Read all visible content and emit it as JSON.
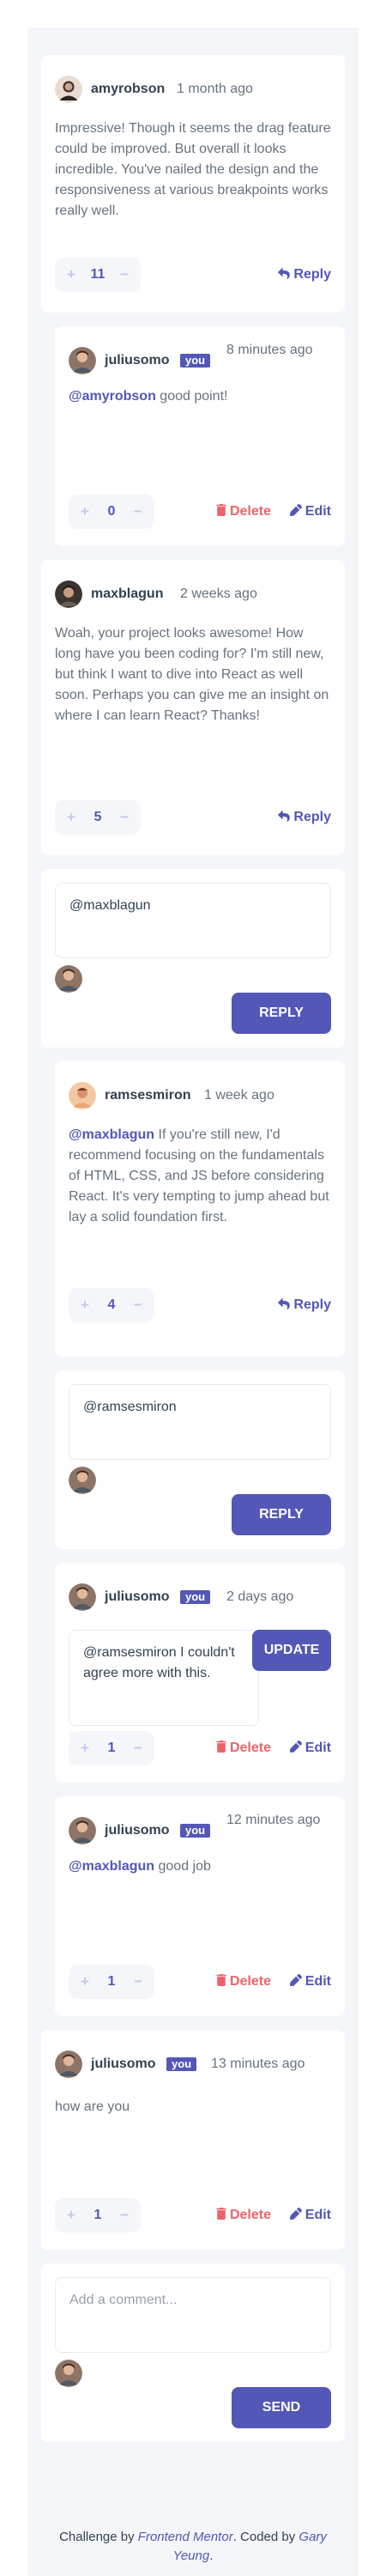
{
  "actions": {
    "reply": "Reply",
    "delete": "Delete",
    "edit": "Edit",
    "you_badge": "you"
  },
  "comments": [
    {
      "username": "amyrobson",
      "date": "1 month ago",
      "content": "Impressive! Though it seems the drag feature could be improved. But overall it looks incredible. You've nailed the design and the responsiveness at various breakpoints works really well.",
      "score": "11"
    },
    {
      "username": "juliusomo",
      "date": "8 minutes ago",
      "mention": "@amyrobson",
      "content": " good point!",
      "score": "0"
    },
    {
      "username": "maxblagun",
      "date": "2 weeks ago",
      "content": "Woah, your project looks awesome! How long have you been coding for? I'm still new, but think I want to dive into React as well soon. Perhaps you can give me an insight on where I can learn React? Thanks!",
      "score": "5"
    },
    {
      "username": "ramsesmiron",
      "date": "1 week ago",
      "mention": "@maxblagun",
      "content": " If you're still new, I'd recommend focusing on the fundamentals of HTML, CSS, and JS before considering React. It's very tempting to jump ahead but lay a solid foundation first.",
      "score": "4"
    },
    {
      "username": "juliusomo",
      "date": "2 days ago",
      "edit_value": "@ramsesmiron I couldn't agree more with this.",
      "score": "1"
    },
    {
      "username": "juliusomo",
      "date": "12 minutes ago",
      "mention": "@maxblagun",
      "content": " good job",
      "score": "1"
    },
    {
      "username": "juliusomo",
      "date": "13 minutes ago",
      "content": "how are you",
      "score": "1"
    }
  ],
  "reply_forms": [
    {
      "value": "@maxblagun",
      "button": "REPLY"
    },
    {
      "value": "@ramsesmiron",
      "button": "REPLY"
    }
  ],
  "update_button": "UPDATE",
  "new_comment": {
    "placeholder": "Add a comment...",
    "button": "SEND"
  },
  "footer": {
    "prefix": "Challenge by ",
    "link1": "Frontend Mentor",
    "middle": ". Coded by ",
    "link2": "Gary Yeung",
    "suffix": "."
  },
  "colors": {
    "accent": "#5357b6",
    "danger": "#ed6368",
    "background": "#f5f6fa",
    "card": "#ffffff"
  },
  "icons": {
    "reply": "reply-icon",
    "delete": "trash-icon",
    "edit": "pencil-icon",
    "upvote": "plus-icon",
    "downvote": "minus-icon"
  }
}
